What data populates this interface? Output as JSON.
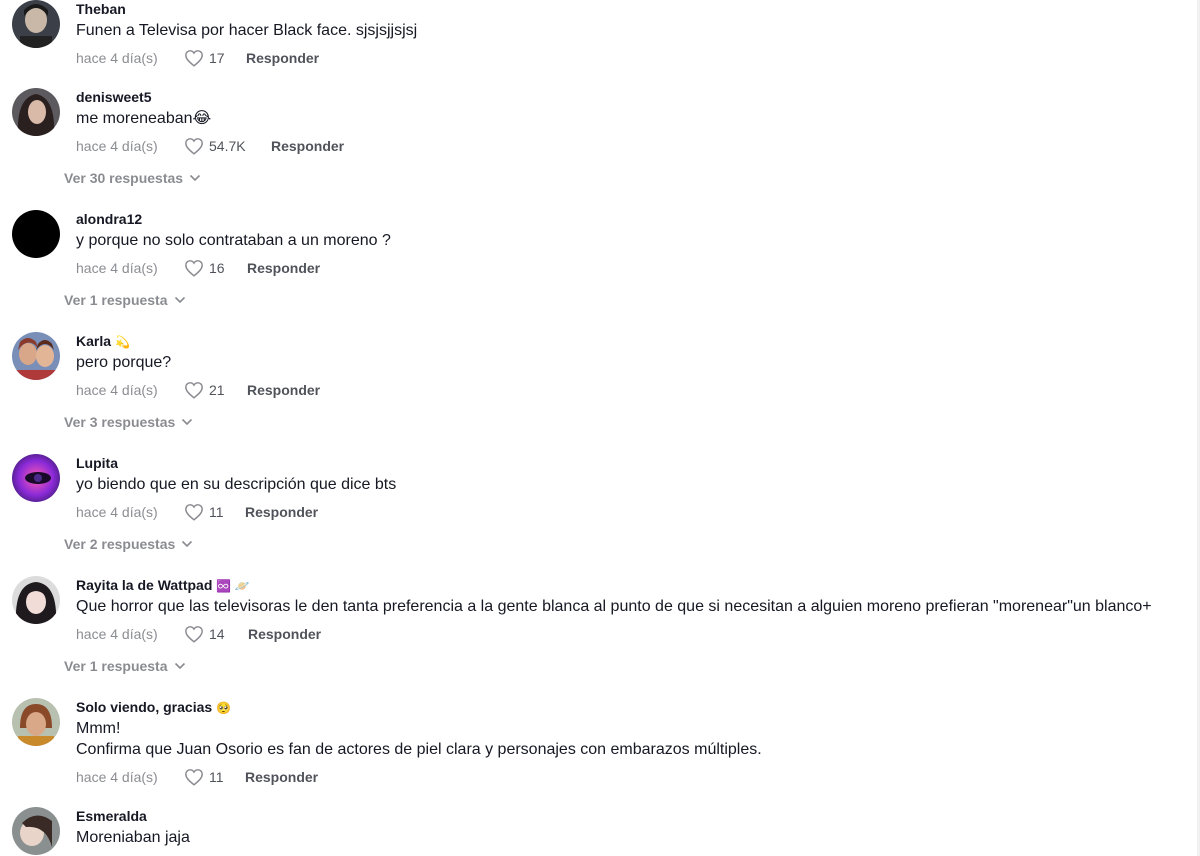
{
  "comments": [
    {
      "user": "Theban",
      "text": "Funen a Televisa por hacer Black face. sjsjsjjsjsj",
      "time": "hace 4 día(s)",
      "likes": "17",
      "reply": "Responder"
    },
    {
      "user": "denisweet5",
      "text": "me moreneaban😂",
      "time": "hace 4 día(s)",
      "likes": "54.7K",
      "reply": "Responder",
      "replies": "Ver 30 respuestas"
    },
    {
      "user": "alondra12",
      "text": "y porque no solo contrataban a un moreno ?",
      "time": "hace 4 día(s)",
      "likes": "16",
      "reply": "Responder",
      "replies": "Ver 1 respuesta"
    },
    {
      "user": "Karla",
      "user_emoji": "💫",
      "text": "pero porque?",
      "time": "hace 4 día(s)",
      "likes": "21",
      "reply": "Responder",
      "replies": "Ver 3 respuestas"
    },
    {
      "user": "Lupita",
      "text": "yo biendo que en su descripción que dice bts",
      "time": "hace 4 día(s)",
      "likes": "11",
      "reply": "Responder",
      "replies": "Ver 2 respuestas"
    },
    {
      "user": "Rayita la de Wattpad",
      "user_emoji": "♾️ 🪐",
      "text": "Que horror que las televisoras le den tanta preferencia a la gente blanca al punto de que si necesitan a alguien moreno prefieran \"morenear\"un blanco+",
      "time": "hace 4 día(s)",
      "likes": "14",
      "reply": "Responder",
      "replies": "Ver 1 respuesta"
    },
    {
      "user": "Solo viendo, gracias",
      "user_emoji": "🥺",
      "text": "Mmm!",
      "text2": "Confirma que Juan Osorio es fan de actores de piel clara y personajes con embarazos múltiples.",
      "time": "hace 4 día(s)",
      "likes": "11",
      "reply": "Responder"
    },
    {
      "user": "Esmeralda",
      "text": "Moreniaban jaja"
    }
  ],
  "colors": {
    "primary_text": "#161823",
    "secondary_text": "#8a8b91",
    "background": "#ffffff"
  }
}
